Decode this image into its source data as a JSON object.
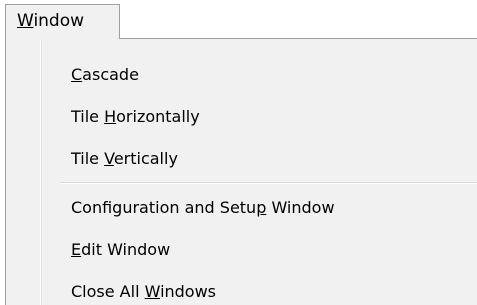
{
  "menubar": {
    "window_menu": {
      "before": "",
      "accel": "W",
      "after": "indow"
    }
  },
  "menu": {
    "items": [
      {
        "before": "",
        "accel": "C",
        "after": "ascade"
      },
      {
        "before": "Tile ",
        "accel": "H",
        "after": "orizontally"
      },
      {
        "before": "Tile ",
        "accel": "V",
        "after": "ertically"
      },
      {
        "before": "Configuration and Setu",
        "accel": "p",
        "after": " Window"
      },
      {
        "before": "",
        "accel": "E",
        "after": "dit Window"
      },
      {
        "before": "Close All ",
        "accel": "W",
        "after": "indows"
      }
    ]
  }
}
